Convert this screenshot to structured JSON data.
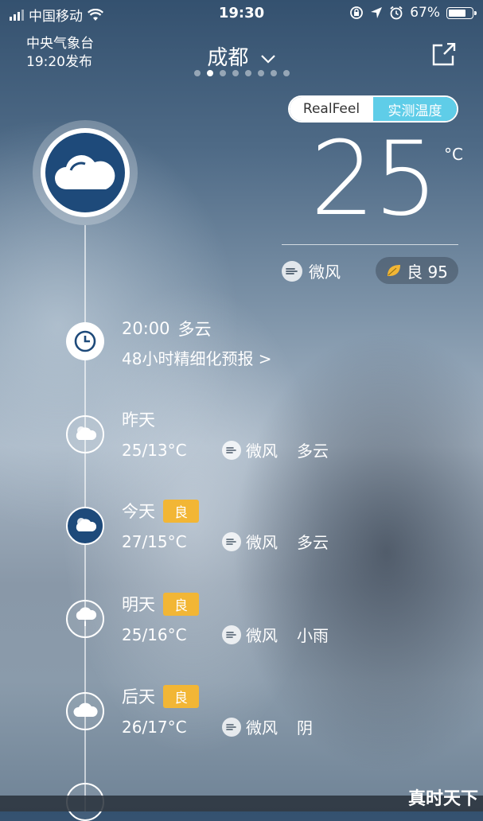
{
  "status_bar": {
    "carrier": "中国移动",
    "time": "19:30",
    "battery": "67%"
  },
  "header": {
    "source": "中央气象台",
    "publish_time": "19:20发布",
    "city": "成都",
    "page_count": 8,
    "active_page": 1
  },
  "toggle": {
    "realfeel": "RealFeel",
    "measured": "实测温度"
  },
  "current": {
    "temperature": "25",
    "unit": "°C",
    "wind": "微风",
    "aqi": "良 95"
  },
  "hourly": {
    "time": "20:00",
    "condition": "多云",
    "link": "48小时精细化预报 >"
  },
  "days": [
    {
      "label": "昨天",
      "badge": "",
      "temp": "25/13°C",
      "wind": "微风",
      "condition": "多云"
    },
    {
      "label": "今天",
      "badge": "良",
      "temp": "27/15°C",
      "wind": "微风",
      "condition": "多云"
    },
    {
      "label": "明天",
      "badge": "良",
      "temp": "25/16°C",
      "wind": "微风",
      "condition": "小雨"
    },
    {
      "label": "后天",
      "badge": "良",
      "temp": "26/17°C",
      "wind": "微风",
      "condition": "阴"
    }
  ],
  "watermark": "真时天下",
  "colors": {
    "accent": "#5fcde8",
    "badge": "#f2b635",
    "icon_blue": "#1e4a7a"
  }
}
